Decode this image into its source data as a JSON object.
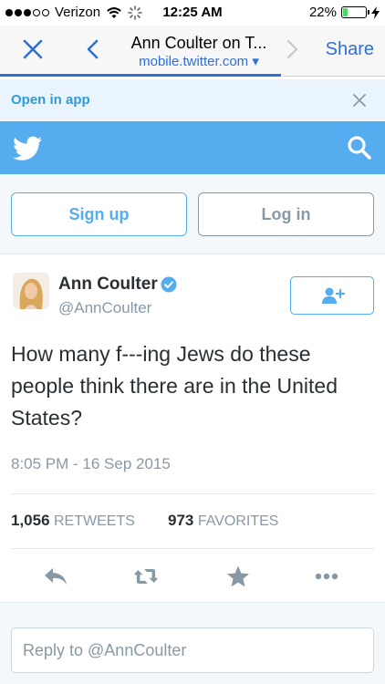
{
  "status_bar": {
    "carrier": "Verizon",
    "time": "12:25 AM",
    "battery_percent": "22%",
    "battery_level": 0.22,
    "icons": [
      "signal-dots-icon",
      "wifi-icon",
      "activity-spinner-icon",
      "battery-icon",
      "charging-bolt-icon"
    ]
  },
  "browser": {
    "page_title": "Ann Coulter on T...",
    "url": "mobile.twitter.com ▾",
    "share_label": "Share",
    "accent": "#2e6fd8",
    "load_progress": 0.73
  },
  "open_in_app": {
    "label": "Open in app"
  },
  "header": {
    "brand_color": "#55acee",
    "icons": [
      "twitter-bird-icon",
      "search-icon"
    ]
  },
  "auth": {
    "signup_label": "Sign up",
    "login_label": "Log in"
  },
  "tweet": {
    "author_name": "Ann Coulter",
    "author_handle": "@AnnCoulter",
    "verified": true,
    "text": "How many f---ing Jews do these people think there are in the United States?",
    "timestamp": "8:05 PM - 16 Sep 2015",
    "retweets_count": "1,056",
    "retweets_label": "RETWEETS",
    "favorites_count": "973",
    "favorites_label": "FAVORITES",
    "actions": [
      "reply-icon",
      "retweet-icon",
      "favorite-star-icon",
      "more-icon"
    ]
  },
  "reply": {
    "placeholder": "Reply to @AnnCoulter"
  }
}
